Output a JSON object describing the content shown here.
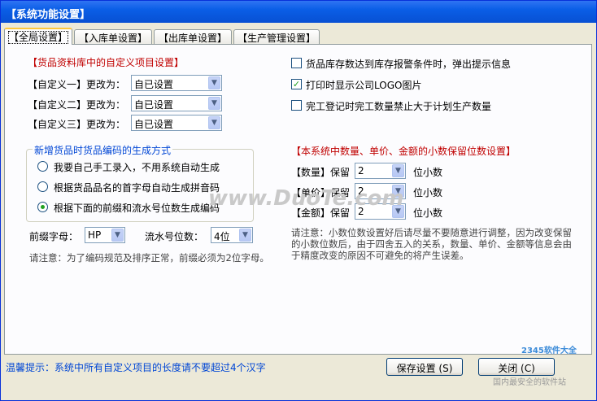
{
  "window": {
    "title": "【系统功能设置】"
  },
  "tabs": [
    {
      "label": "【全局设置】",
      "active": true
    },
    {
      "label": "【入库单设置】",
      "active": false
    },
    {
      "label": "【出库单设置】",
      "active": false
    },
    {
      "label": "【生产管理设置】",
      "active": false
    }
  ],
  "custom_items": {
    "heading": "【货品资料库中的自定义项目设置】",
    "rows": [
      {
        "label": "【自定义一】更改为：",
        "value": "自已设置"
      },
      {
        "label": "【自定义二】更改为：",
        "value": "自已设置"
      },
      {
        "label": "【自定义三】更改为：",
        "value": "自已设置"
      }
    ]
  },
  "code_gen": {
    "legend": "新增货品时货品编码的生成方式",
    "options": [
      {
        "label": "我要自己手工录入，不用系统自动生成",
        "selected": false
      },
      {
        "label": "根据货品品名的首字母自动生成拼音码",
        "selected": false
      },
      {
        "label": "根据下面的前缀和流水号位数生成编码",
        "selected": true
      }
    ],
    "prefix_label": "前缀字母：",
    "prefix_value": "HP",
    "serial_label": "流水号位数：",
    "serial_value": "4位",
    "note": "请注意：为了编码规范及排序正常，前缀必须为2位字母。"
  },
  "options": [
    {
      "label": "货品库存数达到库存报警条件时，弹出提示信息",
      "checked": false
    },
    {
      "label": "打印时显示公司LOGO图片",
      "checked": true
    },
    {
      "label": "完工登记时完工数量禁止大于计划生产数量",
      "checked": false
    }
  ],
  "decimals": {
    "heading": "【本系统中数量、单价、金额的小数保留位数设置】",
    "rows": [
      {
        "label": "【数量】保留",
        "value": "2",
        "unit": "位小数"
      },
      {
        "label": "【单价】保留",
        "value": "2",
        "unit": "位小数"
      },
      {
        "label": "【金额】保留",
        "value": "2",
        "unit": "位小数"
      }
    ],
    "note_lines": [
      "请注意：小数位数设置好后请尽量不要随意进行调整，因为改变保留",
      "的小数位数后，由于四舍五入的关系，数量、单价、金额等信息会由",
      "于精度改变的原因不可避免的将产生误差。"
    ]
  },
  "status": {
    "tip": "温馨提示：系统中所有自定义项目的长度请不要超过4个汉字"
  },
  "buttons": {
    "save": "保存设置 (S)",
    "close": "关闭 (C)"
  },
  "watermarks": {
    "main": "www.DuoTe.com",
    "corner": "2345软件大全",
    "corner_sub": "国内最安全的软件站"
  },
  "colors": {
    "title_bar": "#0a5ee6",
    "heading_red": "#c00000",
    "accent_blue": "#0046d5"
  }
}
